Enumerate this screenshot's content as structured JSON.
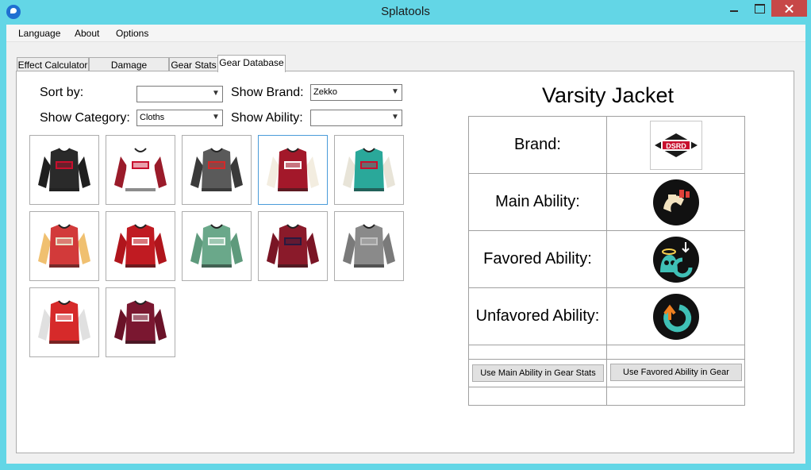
{
  "window": {
    "title": "Splatools"
  },
  "menu": [
    "Language",
    "About",
    "Options"
  ],
  "tabs": [
    "Effect Calculator",
    "Damage Calculator",
    "Gear Stats",
    "Gear Database"
  ],
  "filters": {
    "sort_by_label": "Sort by:",
    "sort_by_value": "",
    "show_brand_label": "Show Brand:",
    "show_brand_value": "Zekko",
    "show_category_label": "Show Category:",
    "show_category_value": "Cloths",
    "show_ability_label": "Show Ability:",
    "show_ability_value": ""
  },
  "gear_items": [
    {
      "icon": "black-zekko-long-sleeve-shirt-icon",
      "body": "#2a2a2a",
      "sleeve": "#1f1f1f",
      "accent": "#c8102e"
    },
    {
      "icon": "white-red-zekko-baseball-tee-icon",
      "body": "#ffffff",
      "sleeve": "#9a1b2a",
      "accent": "#c8102e"
    },
    {
      "icon": "gray-zekko-hoodie-icon",
      "body": "#5a5a5a",
      "sleeve": "#3a3a3a",
      "accent": "#d12a2a"
    },
    {
      "icon": "varsity-jacket-icon",
      "body": "#a3182a",
      "sleeve": "#f3ede0",
      "accent": "#ffffff",
      "selected": true
    },
    {
      "icon": "teal-souvenir-jacket-icon",
      "body": "#2aa89a",
      "sleeve": "#e8e4d8",
      "accent": "#c8102e"
    },
    {
      "icon": "red-dragon-souvenir-jacket-icon",
      "body": "#d23a3a",
      "sleeve": "#f0c070",
      "accent": "#e8e0c8"
    },
    {
      "icon": "red-zekko-sweater-icon",
      "body": "#c01b22",
      "sleeve": "#b0151c",
      "accent": "#ffffff"
    },
    {
      "icon": "green-check-shirt-icon",
      "body": "#6aa88a",
      "sleeve": "#5e9a7c",
      "accent": "#eaf4ee"
    },
    {
      "icon": "red-check-shirt-icon",
      "body": "#8a1a2a",
      "sleeve": "#7a1525",
      "accent": "#2a1a40"
    },
    {
      "icon": "gray-check-shirt-icon",
      "body": "#8a8a8a",
      "sleeve": "#7a7a7a",
      "accent": "#c0c0c0"
    },
    {
      "icon": "red-pattern-shirt-icon",
      "body": "#d62a2a",
      "sleeve": "#e0e0e0",
      "accent": "#ffffff"
    },
    {
      "icon": "burgundy-zekko-sweater-icon",
      "body": "#7a1730",
      "sleeve": "#6a1228",
      "accent": "#e8d8dc"
    }
  ],
  "detail": {
    "name": "Varsity Jacket",
    "rows": [
      {
        "label": "Brand:",
        "icon": "zekko-brand-logo-icon"
      },
      {
        "label": "Main Ability:",
        "icon": "run-speed-up-ability-icon"
      },
      {
        "label": "Favored Ability:",
        "icon": "special-saver-ability-icon"
      },
      {
        "label": "Unfavored Ability:",
        "icon": "special-charge-up-ability-icon"
      }
    ],
    "button_main": "Use Main Ability in Gear Stats",
    "button_favored": "Use Favored Ability in Gear"
  },
  "colors": {
    "titlebar": "#63d6e6",
    "close": "#c74848",
    "selection": "#4a9bd9"
  }
}
